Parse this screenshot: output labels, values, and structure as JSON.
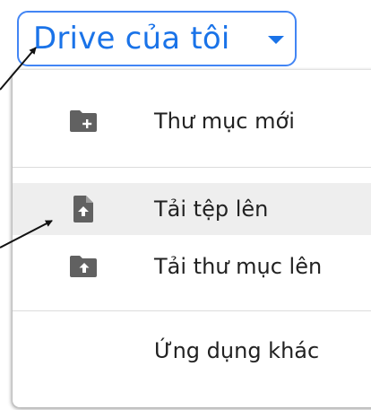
{
  "drive_button": {
    "label": "Drive của tôi",
    "caret_icon": "caret-down-icon",
    "color": "#1a73e8"
  },
  "menu": {
    "items": [
      {
        "label": "Thư mục mới",
        "icon": "new-folder-icon"
      },
      {
        "label": "Tải tệp lên",
        "icon": "file-upload-icon",
        "highlighted": true
      },
      {
        "label": "Tải thư mục lên",
        "icon": "folder-upload-icon"
      },
      {
        "label": "Ứng dụng khác",
        "icon": ""
      }
    ]
  },
  "colors": {
    "accent": "#1a73e8",
    "icon": "#616161",
    "hover_bg": "#eeeeee"
  }
}
